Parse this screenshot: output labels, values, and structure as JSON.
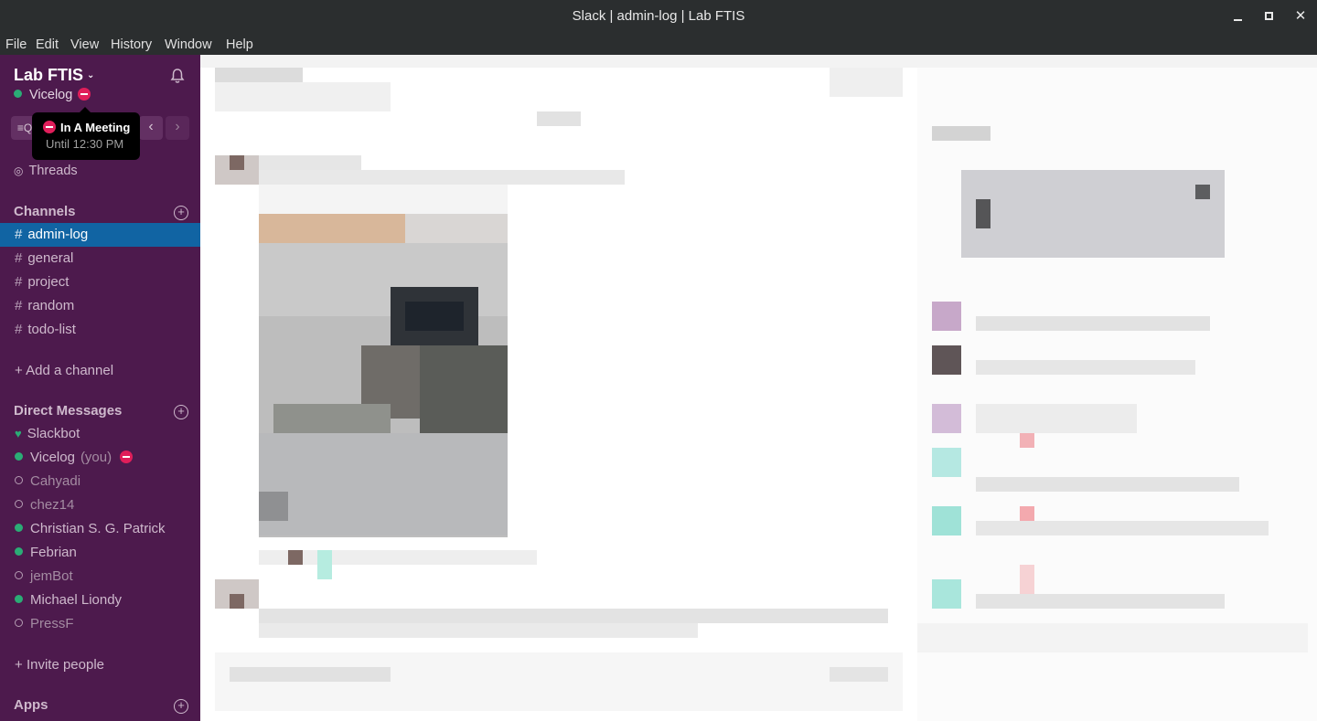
{
  "window": {
    "title": "Slack | admin-log | Lab FTIS"
  },
  "menu": {
    "items": [
      "File",
      "Edit",
      "View",
      "History",
      "Window",
      "Help"
    ]
  },
  "sidebar": {
    "team_name": "Lab FTIS",
    "user_name": "Vicelog",
    "threads_label": "Threads",
    "channels_header": "Channels",
    "channels": [
      {
        "name": "admin-log",
        "active": true
      },
      {
        "name": "general",
        "active": false
      },
      {
        "name": "project",
        "active": false
      },
      {
        "name": "random",
        "active": false
      },
      {
        "name": "todo-list",
        "active": false
      }
    ],
    "add_channel_label": "Add a channel",
    "dm_header": "Direct Messages",
    "dms": [
      {
        "name": "Slackbot",
        "status": "bot"
      },
      {
        "name": "Vicelog",
        "status": "online",
        "you": "(you)"
      },
      {
        "name": "Cahyadi",
        "status": "away"
      },
      {
        "name": "chez14",
        "status": "away"
      },
      {
        "name": "Christian S. G. Patrick",
        "status": "online"
      },
      {
        "name": "Febrian",
        "status": "online"
      },
      {
        "name": "jemBot",
        "status": "away"
      },
      {
        "name": "Michael Liondy",
        "status": "online"
      },
      {
        "name": "PressF",
        "status": "away"
      }
    ],
    "invite_label": "Invite people",
    "apps_header": "Apps"
  },
  "tooltip": {
    "title": "In A Meeting",
    "subtitle": "Until 12:30 PM"
  },
  "colors": {
    "sidebar_bg": "#4d1a4d",
    "active_channel": "#1164a3",
    "presence_online": "#2bac76",
    "dnd": "#e01e5a"
  },
  "icons": {
    "bell": "bell-icon",
    "jump": "quick-switcher-icon",
    "back": "chevron-left-icon",
    "forward": "chevron-right-icon",
    "threads": "threads-icon",
    "add": "plus-circle-icon"
  }
}
